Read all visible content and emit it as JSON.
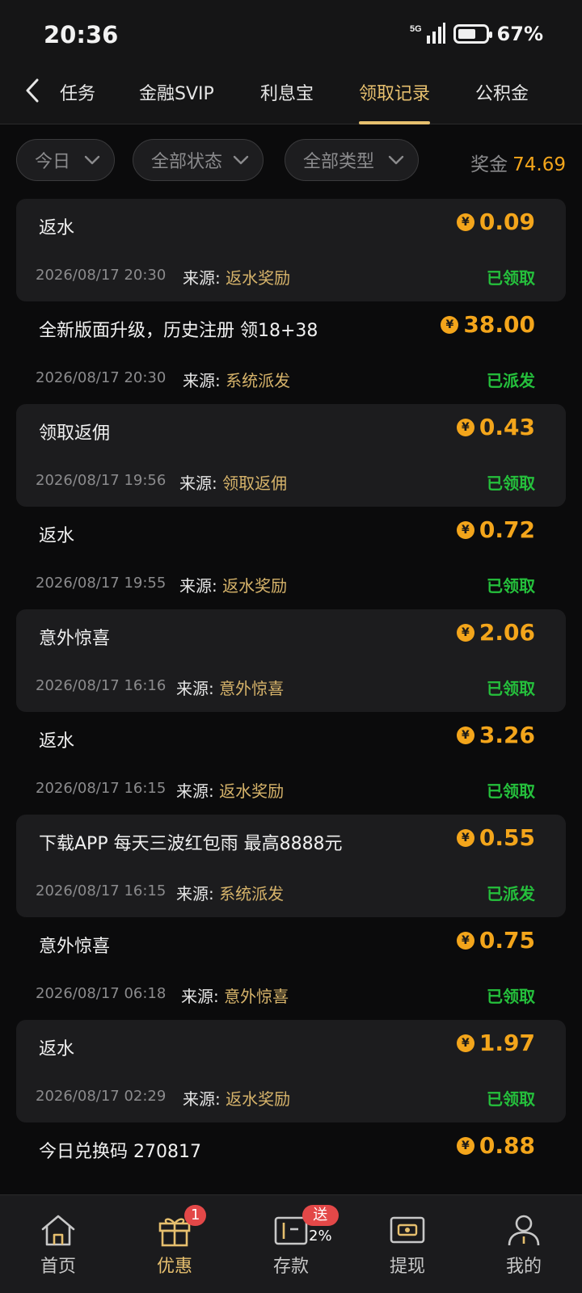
{
  "status_bar": {
    "time": "20:36",
    "network": "5G",
    "battery": "67%",
    "battery_level": 0.67
  },
  "nav": {
    "tabs": [
      {
        "label": "任务",
        "active": false
      },
      {
        "label": "金融SVIP",
        "active": false
      },
      {
        "label": "利息宝",
        "active": false
      },
      {
        "label": "领取记录",
        "active": true
      },
      {
        "label": "公积金",
        "active": false
      }
    ]
  },
  "filters": {
    "date": "今日",
    "status": "全部状态",
    "type": "全部类型",
    "bonus_label": "奖金",
    "bonus_value": "74.69"
  },
  "records": [
    {
      "title": "返水",
      "amount": "0.09",
      "time": "2026/08/17 20:30",
      "source_label": "来源:",
      "source": "返水奖励",
      "status": "已领取"
    },
    {
      "title": "全新版面升级，历史注册 领18+38",
      "amount": "38.00",
      "time": "2026/08/17 20:30",
      "source_label": "来源:",
      "source": "系统派发",
      "status": "已派发"
    },
    {
      "title": "领取返佣",
      "amount": "0.43",
      "time": "2026/08/17 19:56",
      "source_label": "来源:",
      "source": "领取返佣",
      "status": "已领取"
    },
    {
      "title": "返水",
      "amount": "0.72",
      "time": "2026/08/17 19:55",
      "source_label": "来源:",
      "source": "返水奖励",
      "status": "已领取"
    },
    {
      "title": "意外惊喜",
      "amount": "2.06",
      "time": "2026/08/17 16:16",
      "source_label": "来源:",
      "source": "意外惊喜",
      "status": "已领取"
    },
    {
      "title": "返水",
      "amount": "3.26",
      "time": "2026/08/17 16:15",
      "source_label": "来源:",
      "source": "返水奖励",
      "status": "已领取"
    },
    {
      "title": "下载APP 每天三波红包雨 最高8888元",
      "amount": "0.55",
      "time": "2026/08/17 16:15",
      "source_label": "来源:",
      "source": "系统派发",
      "status": "已派发"
    },
    {
      "title": "意外惊喜",
      "amount": "0.75",
      "time": "2026/08/17 06:18",
      "source_label": "来源:",
      "source": "意外惊喜",
      "status": "已领取"
    },
    {
      "title": "返水",
      "amount": "1.97",
      "time": "2026/08/17 02:29",
      "source_label": "来源:",
      "source": "返水奖励",
      "status": "已领取"
    },
    {
      "title": "今日兑换码 270817",
      "amount": "0.88",
      "time": "",
      "source_label": "",
      "source": "",
      "status": ""
    }
  ],
  "currency_symbol": "¥",
  "bottom_nav": {
    "items": [
      {
        "label": "首页",
        "icon": "home-icon"
      },
      {
        "label": "优惠",
        "icon": "gift-icon",
        "badge": "1"
      },
      {
        "label": "存款",
        "icon": "wallet-icon",
        "badge": "送2%"
      },
      {
        "label": "提现",
        "icon": "withdraw-icon"
      },
      {
        "label": "我的",
        "icon": "profile-icon"
      }
    ]
  },
  "colors": {
    "accent": "#e6bf6e",
    "amount": "#f3a51b",
    "status_green": "#25c03c",
    "badge_red": "#e34848"
  }
}
